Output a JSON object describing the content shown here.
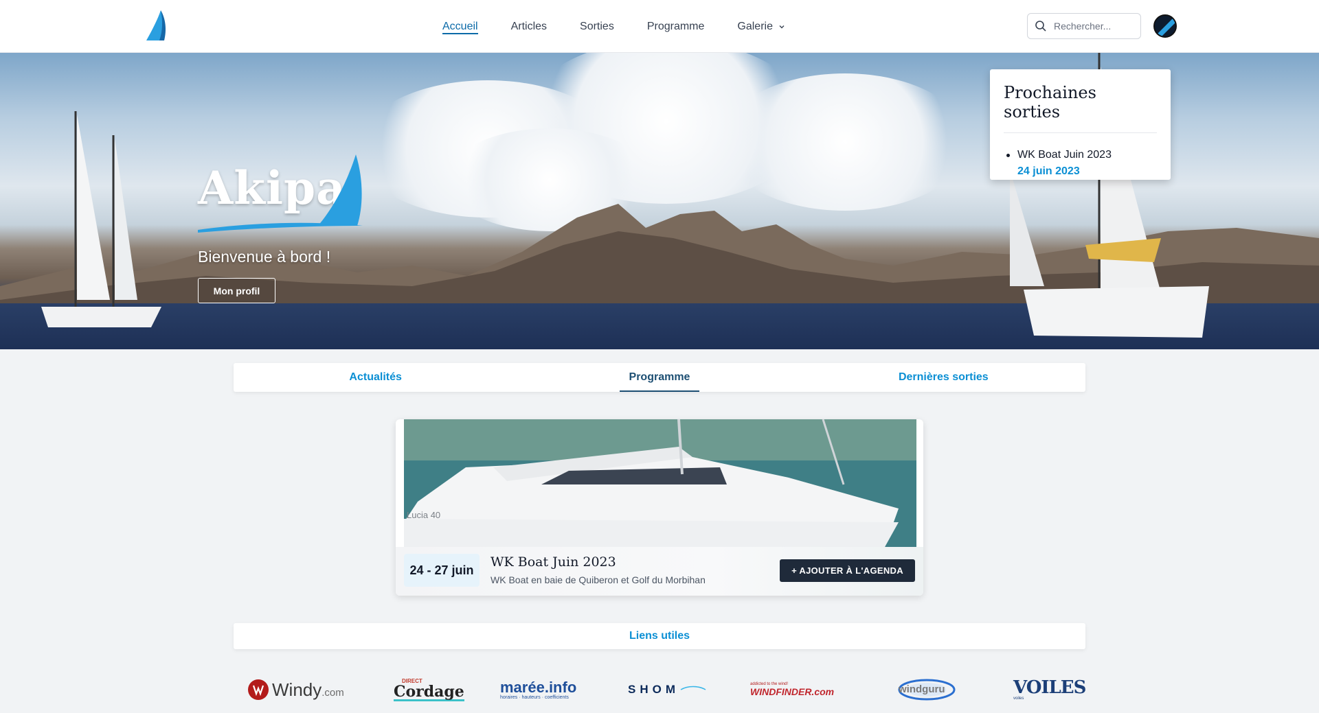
{
  "header": {
    "nav": [
      {
        "label": "Accueil",
        "active": true
      },
      {
        "label": "Articles",
        "active": false
      },
      {
        "label": "Sorties",
        "active": false
      },
      {
        "label": "Programme",
        "active": false
      },
      {
        "label": "Galerie",
        "active": false,
        "dropdown": true
      }
    ],
    "search_placeholder": "Rechercher..."
  },
  "hero": {
    "brand": "Akipaj",
    "welcome": "Bienvenue à bord !",
    "profile_button": "Mon profil"
  },
  "upcoming": {
    "title": "Prochaines sorties",
    "items": [
      {
        "name": "WK Boat Juin 2023",
        "date": "24 juin 2023"
      }
    ]
  },
  "tabs": [
    {
      "label": "Actualités",
      "active": false
    },
    {
      "label": "Programme",
      "active": true
    },
    {
      "label": "Dernières sorties",
      "active": false
    }
  ],
  "event": {
    "dates": "24 - 27 juin",
    "title": "WK Boat Juin 2023",
    "subtitle": "WK Boat en baie de Quiberon et Golf du Morbihan",
    "agenda_button": "+ AJOUTER À L'AGENDA",
    "hull_text": "Lucia 40"
  },
  "links": {
    "title": "Liens utiles",
    "partners": [
      {
        "name": "Windy",
        "suffix": ".com"
      },
      {
        "name": "Cordage",
        "top": "DIRECT"
      },
      {
        "name": "marée.info",
        "tagline": "horaires · hauteurs · coefficients"
      },
      {
        "name": "SHOM"
      },
      {
        "name": "WINDFINDER.com",
        "tagline": "addicted to the wind!"
      },
      {
        "name": "windguru"
      },
      {
        "name": "VOILES",
        "small": "voiles"
      }
    ]
  },
  "colors": {
    "accent": "#0b8fd4",
    "nav_active": "#0b6aa8",
    "tab_active": "#1d4f73",
    "dark_button": "#1f2a3a"
  }
}
